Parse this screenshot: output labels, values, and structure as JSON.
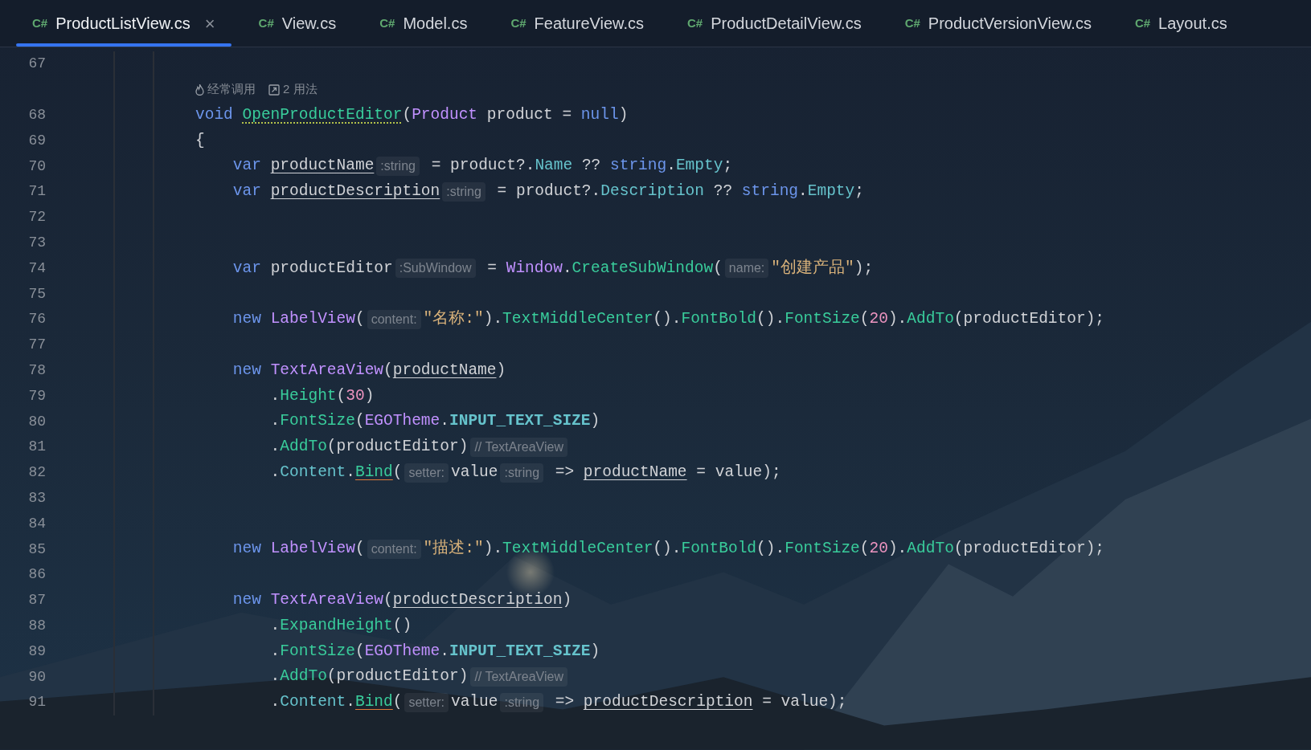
{
  "tabs": [
    {
      "lang": "C#",
      "label": "ProductListView.cs",
      "selected": true,
      "close": "×"
    },
    {
      "lang": "C#",
      "label": "View.cs",
      "selected": false
    },
    {
      "lang": "C#",
      "label": "Model.cs",
      "selected": false
    },
    {
      "lang": "C#",
      "label": "FeatureView.cs",
      "selected": false
    },
    {
      "lang": "C#",
      "label": "ProductDetailView.cs",
      "selected": false
    },
    {
      "lang": "C#",
      "label": "ProductVersionView.cs",
      "selected": false
    },
    {
      "lang": "C#",
      "label": "Layout.cs",
      "selected": false
    }
  ],
  "lines": [
    {
      "number": "67"
    },
    {
      "number": "68",
      "code_vision": [
        {
          "kind": "hot",
          "text": "经常调用"
        },
        {
          "kind": "usages",
          "text": "2 用法"
        }
      ],
      "parts": [
        {
          "kind": "kw",
          "text": "void "
        },
        {
          "kind": "method_decl",
          "text": "OpenProductEditor"
        },
        {
          "kind": "plain",
          "text": "("
        },
        {
          "kind": "type",
          "text": "Product"
        },
        {
          "kind": "plain",
          "text": " product = "
        },
        {
          "kind": "kw",
          "text": "null"
        },
        {
          "kind": "plain",
          "text": ")"
        }
      ]
    },
    {
      "number": "69",
      "parts": [
        {
          "kind": "plain",
          "text": "{"
        }
      ]
    },
    {
      "number": "70",
      "parts": [
        {
          "kind": "kw",
          "text": "    var "
        },
        {
          "kind": "local",
          "text": "productName"
        },
        {
          "kind": "hint",
          "text": ":string"
        },
        {
          "kind": "plain",
          "text": " = product?."
        },
        {
          "kind": "prop",
          "text": "Name"
        },
        {
          "kind": "plain",
          "text": " ?? "
        },
        {
          "kind": "kw",
          "text": "string"
        },
        {
          "kind": "plain",
          "text": "."
        },
        {
          "kind": "prop",
          "text": "Empty"
        },
        {
          "kind": "plain",
          "text": ";"
        }
      ]
    },
    {
      "number": "71",
      "parts": [
        {
          "kind": "kw",
          "text": "    var "
        },
        {
          "kind": "local",
          "text": "productDescription"
        },
        {
          "kind": "hint",
          "text": ":string"
        },
        {
          "kind": "plain",
          "text": " = product?."
        },
        {
          "kind": "prop",
          "text": "Description"
        },
        {
          "kind": "plain",
          "text": " ?? "
        },
        {
          "kind": "kw",
          "text": "string"
        },
        {
          "kind": "plain",
          "text": "."
        },
        {
          "kind": "prop",
          "text": "Empty"
        },
        {
          "kind": "plain",
          "text": ";"
        }
      ]
    },
    {
      "number": "72"
    },
    {
      "number": "73"
    },
    {
      "number": "74",
      "parts": [
        {
          "kind": "kw",
          "text": "    var "
        },
        {
          "kind": "plain",
          "text": "productEditor"
        },
        {
          "kind": "hint",
          "text": ":SubWindow"
        },
        {
          "kind": "plain",
          "text": " = "
        },
        {
          "kind": "type",
          "text": "Window"
        },
        {
          "kind": "plain",
          "text": "."
        },
        {
          "kind": "method",
          "text": "CreateSubWindow"
        },
        {
          "kind": "plain",
          "text": "("
        },
        {
          "kind": "hint",
          "text": "name:"
        },
        {
          "kind": "str",
          "text": "\"创建产品\""
        },
        {
          "kind": "plain",
          "text": ");"
        }
      ]
    },
    {
      "number": "75"
    },
    {
      "number": "76",
      "parts": [
        {
          "kind": "kw",
          "text": "    new "
        },
        {
          "kind": "type",
          "text": "LabelView"
        },
        {
          "kind": "plain",
          "text": "("
        },
        {
          "kind": "hint",
          "text": "content:"
        },
        {
          "kind": "str",
          "text": "\"名称:\""
        },
        {
          "kind": "plain",
          "text": ")."
        },
        {
          "kind": "method",
          "text": "TextMiddleCenter"
        },
        {
          "kind": "plain",
          "text": "()."
        },
        {
          "kind": "method",
          "text": "FontBold"
        },
        {
          "kind": "plain",
          "text": "()."
        },
        {
          "kind": "method",
          "text": "FontSize"
        },
        {
          "kind": "plain",
          "text": "("
        },
        {
          "kind": "num",
          "text": "20"
        },
        {
          "kind": "plain",
          "text": ")."
        },
        {
          "kind": "method",
          "text": "AddTo"
        },
        {
          "kind": "plain",
          "text": "(productEditor);"
        }
      ]
    },
    {
      "number": "77"
    },
    {
      "number": "78",
      "parts": [
        {
          "kind": "kw",
          "text": "    new "
        },
        {
          "kind": "type",
          "text": "TextAreaView"
        },
        {
          "kind": "plain",
          "text": "("
        },
        {
          "kind": "local",
          "text": "productName"
        },
        {
          "kind": "plain",
          "text": ")"
        }
      ]
    },
    {
      "number": "79",
      "parts": [
        {
          "kind": "plain",
          "text": "        ."
        },
        {
          "kind": "method",
          "text": "Height"
        },
        {
          "kind": "plain",
          "text": "("
        },
        {
          "kind": "num",
          "text": "30"
        },
        {
          "kind": "plain",
          "text": ")"
        }
      ]
    },
    {
      "number": "80",
      "parts": [
        {
          "kind": "plain",
          "text": "        ."
        },
        {
          "kind": "method",
          "text": "FontSize"
        },
        {
          "kind": "plain",
          "text": "("
        },
        {
          "kind": "type",
          "text": "EGOTheme"
        },
        {
          "kind": "plain",
          "text": "."
        },
        {
          "kind": "const",
          "text": "INPUT_TEXT_SIZE"
        },
        {
          "kind": "plain",
          "text": ")"
        }
      ]
    },
    {
      "number": "81",
      "parts": [
        {
          "kind": "plain",
          "text": "        ."
        },
        {
          "kind": "method",
          "text": "AddTo"
        },
        {
          "kind": "plain",
          "text": "(productEditor)"
        },
        {
          "kind": "hint",
          "text": "// TextAreaView"
        }
      ]
    },
    {
      "number": "82",
      "parts": [
        {
          "kind": "plain",
          "text": "        ."
        },
        {
          "kind": "prop",
          "text": "Content"
        },
        {
          "kind": "plain",
          "text": "."
        },
        {
          "kind": "method_warn",
          "text": "Bind"
        },
        {
          "kind": "plain",
          "text": "("
        },
        {
          "kind": "hint",
          "text": "setter:"
        },
        {
          "kind": "plain",
          "text": "value"
        },
        {
          "kind": "hint",
          "text": ":string"
        },
        {
          "kind": "plain",
          "text": " => "
        },
        {
          "kind": "local",
          "text": "productName"
        },
        {
          "kind": "plain",
          "text": " = value);"
        }
      ]
    },
    {
      "number": "83"
    },
    {
      "number": "84"
    },
    {
      "number": "85",
      "parts": [
        {
          "kind": "kw",
          "text": "    new "
        },
        {
          "kind": "type",
          "text": "LabelView"
        },
        {
          "kind": "plain",
          "text": "("
        },
        {
          "kind": "hint",
          "text": "content:"
        },
        {
          "kind": "str",
          "text": "\"描述:\""
        },
        {
          "kind": "plain",
          "text": ")."
        },
        {
          "kind": "method",
          "text": "TextMiddleCenter"
        },
        {
          "kind": "plain",
          "text": "()."
        },
        {
          "kind": "method",
          "text": "FontBold"
        },
        {
          "kind": "plain",
          "text": "()."
        },
        {
          "kind": "method",
          "text": "FontSize"
        },
        {
          "kind": "plain",
          "text": "("
        },
        {
          "kind": "num",
          "text": "20"
        },
        {
          "kind": "plain",
          "text": ")."
        },
        {
          "kind": "method",
          "text": "AddTo"
        },
        {
          "kind": "plain",
          "text": "(productEditor);"
        }
      ]
    },
    {
      "number": "86"
    },
    {
      "number": "87",
      "parts": [
        {
          "kind": "kw",
          "text": "    new "
        },
        {
          "kind": "type",
          "text": "TextAreaView"
        },
        {
          "kind": "plain",
          "text": "("
        },
        {
          "kind": "local",
          "text": "productDescription"
        },
        {
          "kind": "plain",
          "text": ")"
        }
      ]
    },
    {
      "number": "88",
      "parts": [
        {
          "kind": "plain",
          "text": "        ."
        },
        {
          "kind": "method",
          "text": "ExpandHeight"
        },
        {
          "kind": "plain",
          "text": "()"
        }
      ]
    },
    {
      "number": "89",
      "parts": [
        {
          "kind": "plain",
          "text": "        ."
        },
        {
          "kind": "method",
          "text": "FontSize"
        },
        {
          "kind": "plain",
          "text": "("
        },
        {
          "kind": "type",
          "text": "EGOTheme"
        },
        {
          "kind": "plain",
          "text": "."
        },
        {
          "kind": "const",
          "text": "INPUT_TEXT_SIZE"
        },
        {
          "kind": "plain",
          "text": ")"
        }
      ]
    },
    {
      "number": "90",
      "parts": [
        {
          "kind": "plain",
          "text": "        ."
        },
        {
          "kind": "method",
          "text": "AddTo"
        },
        {
          "kind": "plain",
          "text": "(productEditor)"
        },
        {
          "kind": "hint",
          "text": "// TextAreaView"
        }
      ]
    },
    {
      "number": "91",
      "parts": [
        {
          "kind": "plain",
          "text": "        ."
        },
        {
          "kind": "prop",
          "text": "Content"
        },
        {
          "kind": "plain",
          "text": "."
        },
        {
          "kind": "method_warn",
          "text": "Bind"
        },
        {
          "kind": "plain",
          "text": "("
        },
        {
          "kind": "hint",
          "text": "setter:"
        },
        {
          "kind": "plain",
          "text": "value"
        },
        {
          "kind": "hint",
          "text": ":string"
        },
        {
          "kind": "plain",
          "text": " => "
        },
        {
          "kind": "local",
          "text": "productDescription"
        },
        {
          "kind": "plain",
          "text": " = value);"
        }
      ]
    }
  ]
}
